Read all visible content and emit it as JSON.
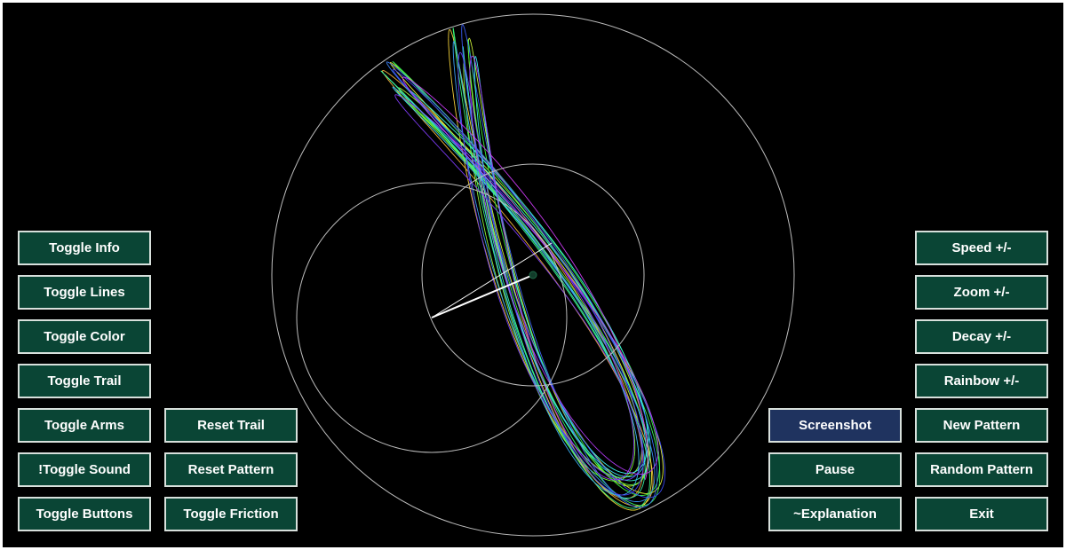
{
  "colors": {
    "background": "#000000",
    "button_fill": "#0a4535",
    "button_fill_highlight": "#1f335f",
    "button_border": "#d8e0dc",
    "button_text": "#ffffff",
    "guide_circle": "#bdbdbd",
    "arm": "#ffffff",
    "pivot": "#123b2a"
  },
  "left_buttons": [
    {
      "label": "Toggle Info"
    },
    {
      "label": "Toggle Lines"
    },
    {
      "label": "Toggle Color"
    },
    {
      "label": "Toggle Trail"
    },
    {
      "label": "Toggle Arms"
    },
    {
      "label": "!Toggle Sound"
    },
    {
      "label": "Toggle Buttons"
    }
  ],
  "left_buttons_2": [
    {
      "label": "Reset Trail"
    },
    {
      "label": "Reset Pattern"
    },
    {
      "label": "Toggle Friction"
    }
  ],
  "right_buttons_1": [
    {
      "label": "Screenshot"
    },
    {
      "label": "Pause"
    },
    {
      "label": "~Explanation"
    }
  ],
  "right_buttons_2": [
    {
      "label": "Speed +/-"
    },
    {
      "label": "Zoom +/-"
    },
    {
      "label": "Decay +/-"
    },
    {
      "label": "Rainbow +/-"
    },
    {
      "label": "New Pattern"
    },
    {
      "label": "Random Pattern"
    },
    {
      "label": "Exit"
    }
  ]
}
